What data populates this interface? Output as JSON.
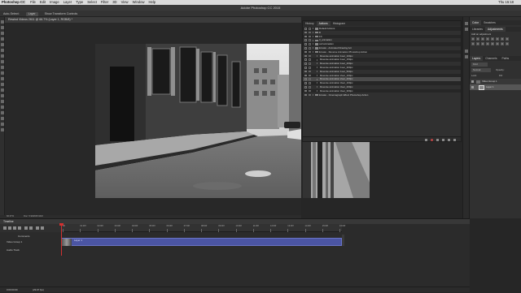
{
  "menubar": {
    "app": "Photoshop CC",
    "items": [
      "File",
      "Edit",
      "Image",
      "Layer",
      "Type",
      "Select",
      "Filter",
      "3D",
      "View",
      "Window",
      "Help"
    ],
    "clock": "Thu 15:18"
  },
  "window": {
    "title": "Adobe Photoshop CC 2015"
  },
  "options": {
    "auto_select": "Auto-Select:",
    "layer_mode": "Layer",
    "show_transform": "Show Transform Controls"
  },
  "document": {
    "tab_title": "Rewind Videos 2611 @ 66.7% (Layer 1, RGB/8) *"
  },
  "actions_panel": {
    "tabs": [
      "History",
      "Actions",
      "Histogram"
    ],
    "active_tab": "Actions",
    "rows": [
      {
        "label": "Default Actions",
        "indent": 0,
        "selected": false
      },
      {
        "label": "lll",
        "indent": 0,
        "selected": false
      },
      {
        "label": "FX",
        "indent": 0,
        "selected": false
      },
      {
        "label": "3_animation",
        "indent": 0,
        "selected": false
      },
      {
        "label": "cell animation",
        "indent": 0,
        "selected": false
      },
      {
        "label": "Envato - Animated Drawing Act",
        "indent": 0,
        "selected": false
      },
      {
        "label": "Envato - Reverse Animation Photoshop Action",
        "indent": 0,
        "selected": false
      },
      {
        "label": "Reverse animation 1sec_100px",
        "indent": 1,
        "selected": false
      },
      {
        "label": "Reverse animation 1sec_150px",
        "indent": 1,
        "selected": false
      },
      {
        "label": "Reverse animation 1sec_200px",
        "indent": 1,
        "selected": false
      },
      {
        "label": "Reverse animation 1sec_300px",
        "indent": 1,
        "selected": false
      },
      {
        "label": "Reverse animation 1sec_500px",
        "indent": 1,
        "selected": false
      },
      {
        "label": "Reverse animation 2sec_100px",
        "indent": 1,
        "selected": false
      },
      {
        "label": "Reverse animation 2sec_200px",
        "indent": 1,
        "selected": true
      },
      {
        "label": "Reverse animation 3sec_100px",
        "indent": 1,
        "selected": false
      },
      {
        "label": "Reverse animation 3sec_200px",
        "indent": 1,
        "selected": false
      },
      {
        "label": "Reverse animation 3sec_300px",
        "indent": 1,
        "selected": false
      },
      {
        "label": "Envato - Cinemagraph Effect Photoshop Action",
        "indent": 0,
        "selected": false
      }
    ]
  },
  "right_panels": {
    "color_tabs": [
      "Color",
      "Swatches"
    ],
    "adjust_tabs": [
      "Libraries",
      "Adjustments"
    ],
    "add_adjustment": "Add an adjustment",
    "layers_tabs": [
      "Layers",
      "Channels",
      "Paths"
    ],
    "kind_filter": "Kind",
    "blend_mode": "Normal",
    "opacity_label": "Opacity:",
    "lock_label": "Lock:",
    "fill_label": "Fill:",
    "layers": [
      {
        "name": "Video Group 1",
        "type": "group"
      },
      {
        "name": "Layer 1",
        "type": "layer"
      }
    ]
  },
  "status": {
    "zoom": "66.67%",
    "doc_size": "Doc: 5.93M/25.91M"
  },
  "timeline": {
    "title": "Timeline",
    "ticks": [
      "00",
      "01:00f",
      "02:00f",
      "03:00f",
      "04:00f",
      "05:00f",
      "06:00f",
      "07:00f",
      "08:00f",
      "09:00f",
      "10:00f",
      "11:00f",
      "12:00f",
      "13:00f",
      "14:00f",
      "15:00f",
      "16:00f"
    ],
    "tracks": [
      {
        "label": "Comments"
      },
      {
        "label": "Video Group 1"
      },
      {
        "label": "Audio Track"
      }
    ],
    "clip_label": "Layer 1",
    "current_time": "0:00:00:00",
    "fps": "(29.97 fps)"
  }
}
